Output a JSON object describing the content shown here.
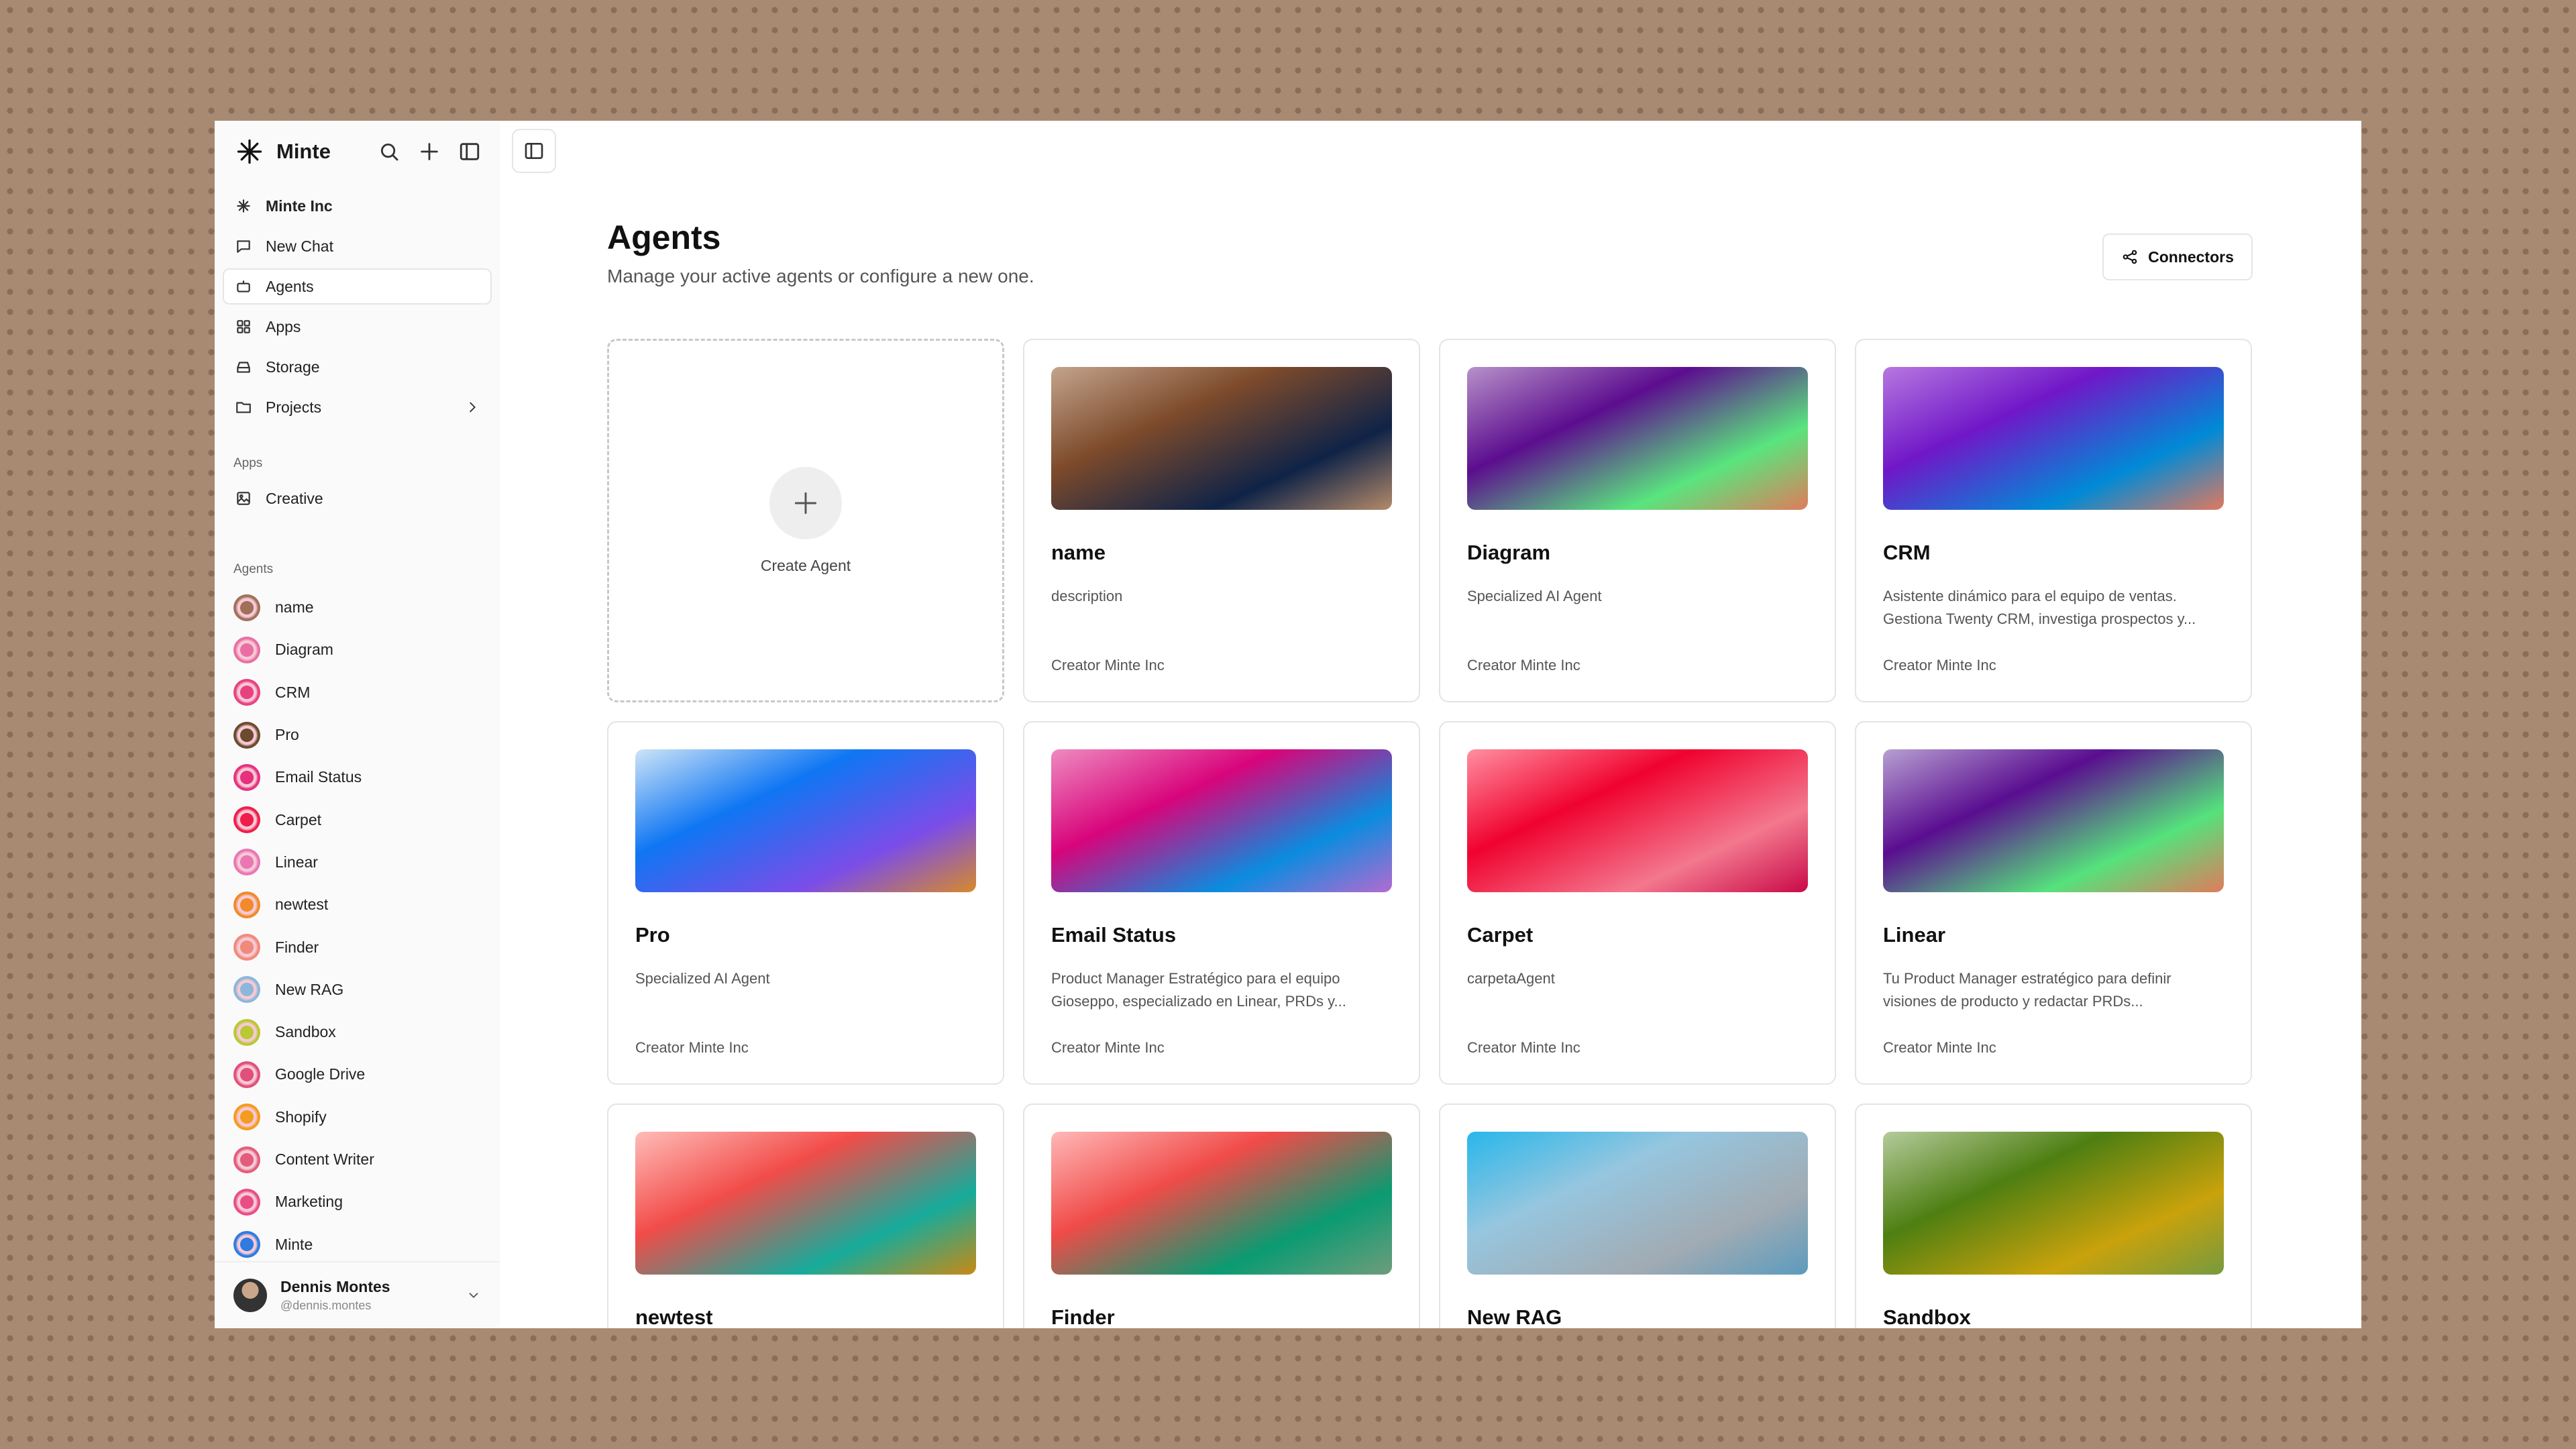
{
  "brand": {
    "name": "Minte"
  },
  "nav": [
    {
      "label": "Minte Inc",
      "icon": "asterisk-icon"
    },
    {
      "label": "New Chat",
      "icon": "chat-icon"
    },
    {
      "label": "Agents",
      "icon": "robot-icon",
      "active": true
    },
    {
      "label": "Apps",
      "icon": "grid-icon"
    },
    {
      "label": "Storage",
      "icon": "storage-icon"
    },
    {
      "label": "Projects",
      "icon": "folder-icon"
    }
  ],
  "apps_section": {
    "label": "Apps",
    "items": [
      {
        "label": "Creative"
      }
    ]
  },
  "agents_section": {
    "label": "Agents",
    "items": [
      {
        "label": "name",
        "color": "#a0705a"
      },
      {
        "label": "Diagram",
        "color": "#e96fa3"
      },
      {
        "label": "CRM",
        "color": "#e9417f"
      },
      {
        "label": "Pro",
        "color": "#6b4a2e"
      },
      {
        "label": "Email Status",
        "color": "#e7307e"
      },
      {
        "label": "Carpet",
        "color": "#ee1d4a"
      },
      {
        "label": "Linear",
        "color": "#e977b3"
      },
      {
        "label": "newtest",
        "color": "#f08a2a"
      },
      {
        "label": "Finder",
        "color": "#f08a7a"
      },
      {
        "label": "New RAG",
        "color": "#8bb8d8"
      },
      {
        "label": "Sandbox",
        "color": "#b9c833"
      },
      {
        "label": "Google Drive",
        "color": "#e14f7b"
      },
      {
        "label": "Shopify",
        "color": "#f49b21"
      },
      {
        "label": "Content Writer",
        "color": "#e35c7c"
      },
      {
        "label": "Marketing",
        "color": "#e94d85"
      },
      {
        "label": "Minte",
        "color": "#2f7be0"
      }
    ]
  },
  "user": {
    "name": "Dennis Montes",
    "handle": "@dennis.montes"
  },
  "page": {
    "title": "Agents",
    "subtitle": "Manage your active agents or configure a new one.",
    "connectors_label": "Connectors",
    "create_label": "Create Agent"
  },
  "cards": [
    {
      "name": "name",
      "description": "description",
      "creator": "Creator Minte Inc",
      "gradient": [
        "#c3a48c",
        "#7d4a2b",
        "#0f2347",
        "#b48a6a"
      ]
    },
    {
      "name": "Diagram",
      "description": "Specialized AI Agent",
      "creator": "Creator Minte Inc",
      "gradient": [
        "#b791c9",
        "#5c0d8f",
        "#59e57e",
        "#e07c5a"
      ]
    },
    {
      "name": "CRM",
      "description": "Asistente dinámico para el equipo de ventas. Gestiona Twenty CRM, investiga prospectos y...",
      "creator": "Creator Minte Inc",
      "gradient": [
        "#b678e0",
        "#7017c8",
        "#008ad6",
        "#e0795f"
      ]
    },
    {
      "name": "Pro",
      "description": "Specialized AI Agent",
      "creator": "Creator Minte Inc",
      "gradient": [
        "#cde4f7",
        "#0f76f3",
        "#7b4de8",
        "#d68a2b"
      ]
    },
    {
      "name": "Email Status",
      "description": "Product Manager Estratégico para el equipo Gioseppo, especializado en Linear, PRDs y...",
      "creator": "Creator Minte Inc",
      "gradient": [
        "#ee8bc0",
        "#d8047b",
        "#0a8cdf",
        "#b46ad0"
      ]
    },
    {
      "name": "Carpet",
      "description": "carpetaAgent",
      "creator": "Creator Minte Inc",
      "gradient": [
        "#ff8fa0",
        "#f0022f",
        "#f3788e",
        "#c90a48"
      ]
    },
    {
      "name": "Linear",
      "description": "Tu Product Manager estratégico para definir visiones de producto y redactar PRDs...",
      "creator": "Creator Minte Inc",
      "gradient": [
        "#b7a0d2",
        "#5a0d90",
        "#55e27c",
        "#e07b5c"
      ]
    },
    {
      "name": "newtest",
      "description": "",
      "creator": "",
      "gradient": [
        "#ffbcb8",
        "#f24c49",
        "#16ab9b",
        "#c88a15"
      ]
    },
    {
      "name": "Finder",
      "description": "",
      "creator": "",
      "gradient": [
        "#ffb8b8",
        "#f04b48",
        "#0a9b72",
        "#6f9c7c"
      ]
    },
    {
      "name": "New RAG",
      "description": "",
      "creator": "",
      "gradient": [
        "#28b7ea",
        "#96c6df",
        "#a1abb3",
        "#5c9bbd"
      ]
    },
    {
      "name": "Sandbox",
      "description": "",
      "creator": "",
      "gradient": [
        "#b5cb9b",
        "#4e7f12",
        "#c9a20c",
        "#769a3e"
      ]
    }
  ]
}
